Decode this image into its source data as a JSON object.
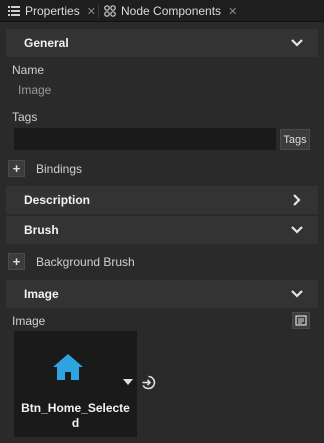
{
  "tabs": [
    {
      "label": "Properties",
      "icon": "list-icon"
    },
    {
      "label": "Node Components",
      "icon": "components-icon"
    }
  ],
  "sections": {
    "general": "General",
    "description": "Description",
    "brush": "Brush",
    "image": "Image"
  },
  "general": {
    "name_label": "Name",
    "name_value": "Image",
    "tags_label": "Tags",
    "tags_button": "Tags",
    "bindings_label": "Bindings"
  },
  "brush": {
    "background_brush_label": "Background Brush"
  },
  "image": {
    "field_label": "Image",
    "asset_name": "Btn_Home_Selected",
    "accent": "#2fa3e0"
  },
  "plus": "+"
}
